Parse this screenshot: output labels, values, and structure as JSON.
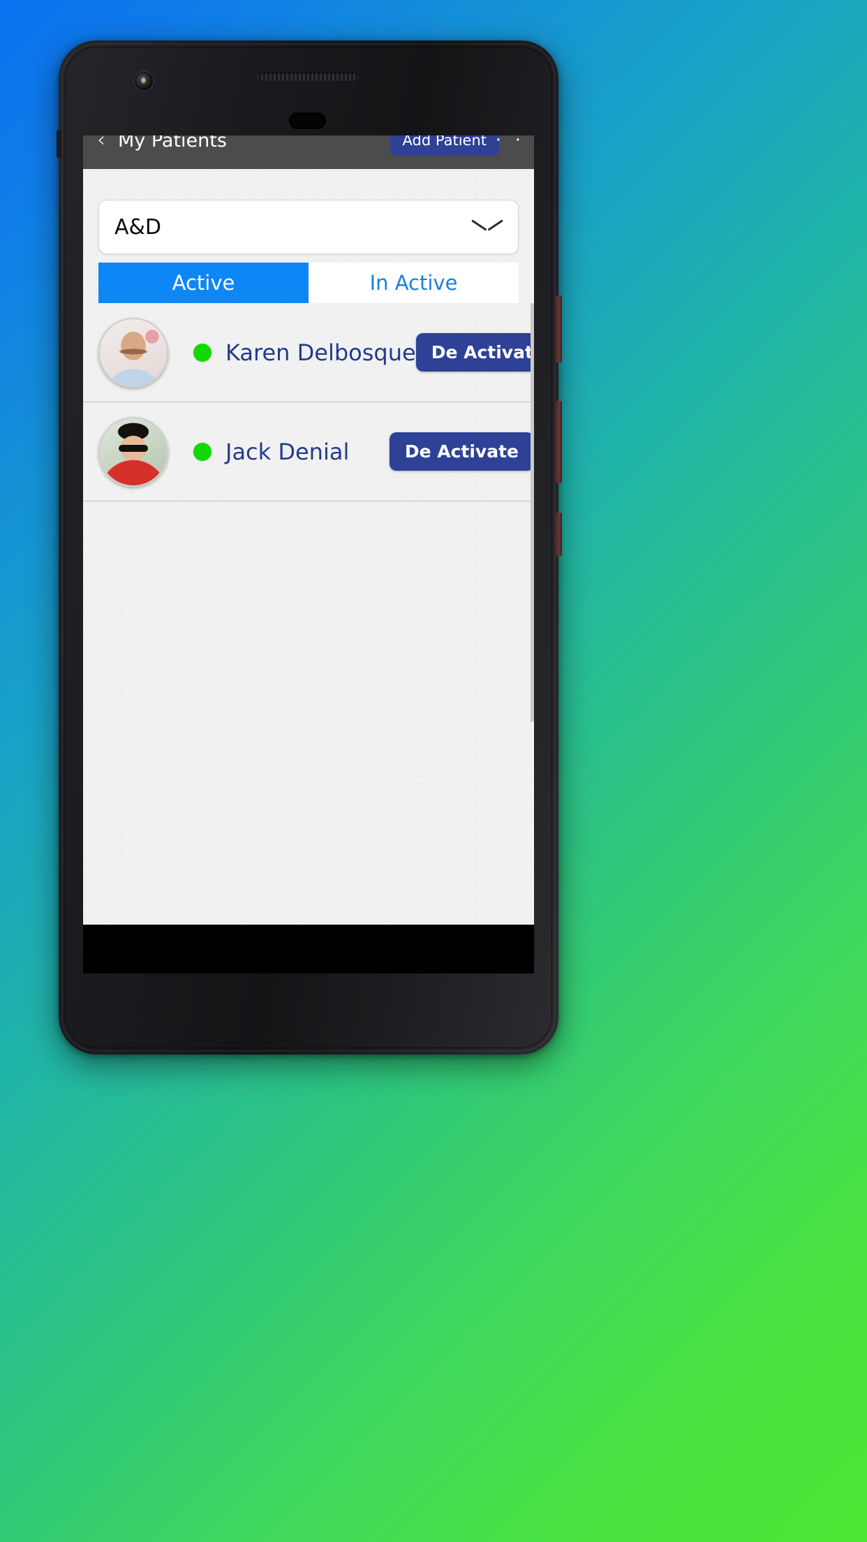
{
  "app": {
    "header": {
      "back_icon": "chevron-left-icon",
      "title": "My Patients",
      "add_patient_label": "Add Patient",
      "menu_icon": "more-options-icon",
      "bg_color": "#4c4c4c",
      "button_color": "#2e4196"
    },
    "dropdown": {
      "selected_value": "A&D",
      "icon": "chevron-down-icon"
    },
    "tabs": [
      {
        "label": "Active",
        "selected": true,
        "bg": "#0d87f5",
        "fg": "#ffffff"
      },
      {
        "label": "In Active",
        "selected": false,
        "bg": "#ffffff",
        "fg": "#1a7fe0"
      }
    ],
    "patients": [
      {
        "name": "Karen Delbosque",
        "status_dot_color": "#12d900",
        "action_label": "De Activate",
        "avatar": "photo-man-light-blue-shirt"
      },
      {
        "name": "Jack Denial",
        "status_dot_color": "#12d900",
        "action_label": "De Activate",
        "avatar": "photo-person-red-shirt-sunglasses"
      }
    ]
  },
  "device": {
    "camera_icon": "front-camera",
    "speaker_icon": "earpiece-speaker",
    "sensor_icon": "proximity-sensor"
  },
  "background": {
    "gradient_start": "#0b72f0",
    "gradient_mid": "#21b4a8",
    "gradient_end": "#4ee635"
  }
}
